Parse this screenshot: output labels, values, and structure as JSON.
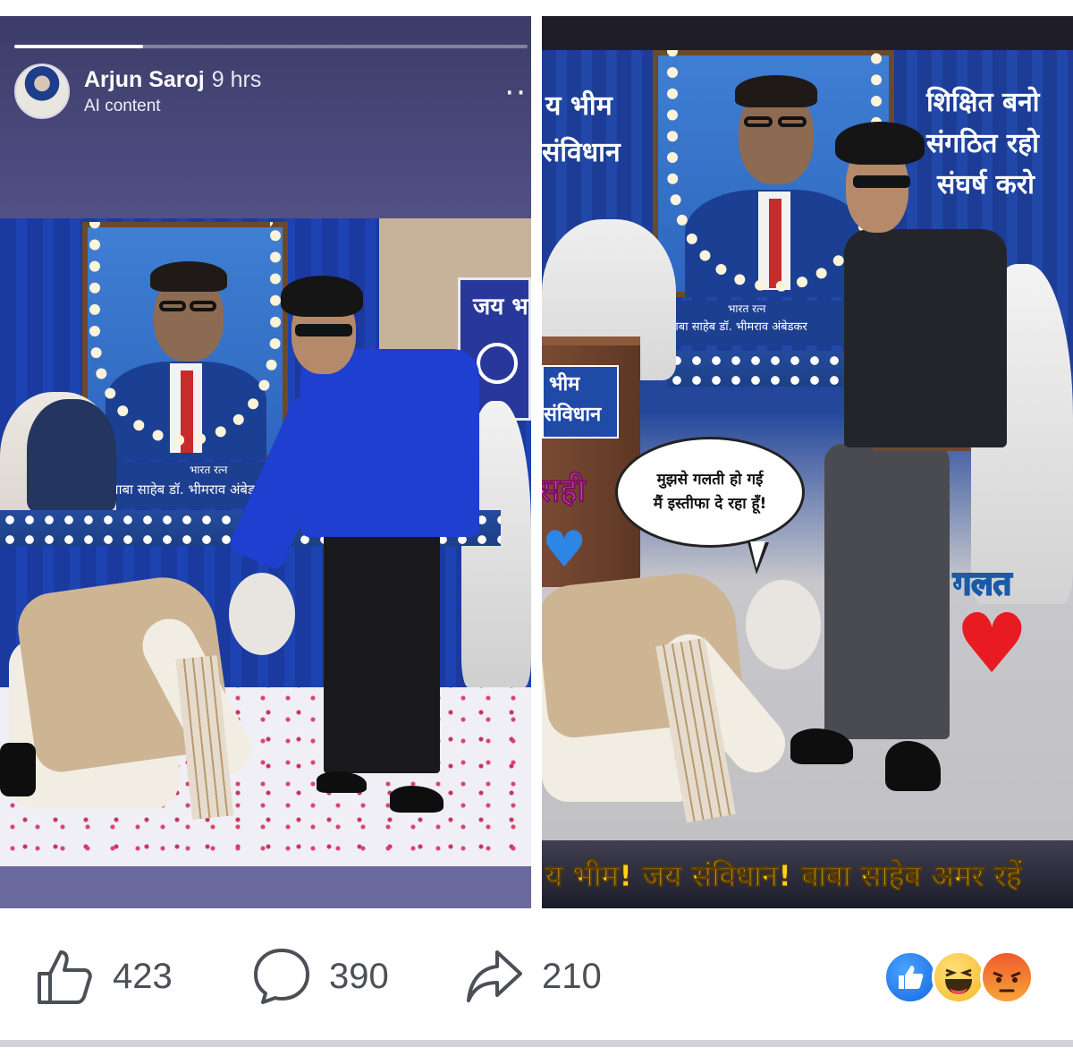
{
  "post": {
    "author_name": "Arjun Saroj",
    "time_ago": "9 hrs",
    "label": "AI content",
    "more_icon": "more-dots-icon",
    "story_progress": 0.25
  },
  "left_image": {
    "banner_partial": "जय भ",
    "portrait_caption_line1": "भारत रत्न",
    "portrait_caption_line2": "बाबा साहेब डॉ. भीमराव अंबेडकर"
  },
  "right_image": {
    "banner_left_line1": "य भीम",
    "banner_left_line2": "संविधान",
    "banner_right_line1": "शिक्षित बनो",
    "banner_right_line2": "संगठित रहो",
    "banner_right_line3": "संघर्ष करो",
    "portrait_caption_line1": "भारत रत्न",
    "portrait_caption_line2": "बाबा साहेब डॉ. भीमराव अंबेडकर",
    "podium_line1": "भीम",
    "podium_line2": "संविधान",
    "speech_line1": "मुझसे गलती हो गई",
    "speech_line2": "मैं इस्तीफा दे रहा हूँ!",
    "label_sahi": "सही",
    "label_galat": "गलत",
    "caption": "य भीम! जय संविधान! बाबा साहेब अमर रहें"
  },
  "actions": {
    "like_count": "423",
    "comment_count": "390",
    "share_count": "210",
    "like_icon": "thumbs-up-icon",
    "comment_icon": "comment-bubble-icon",
    "share_icon": "share-arrow-icon"
  },
  "reactions": [
    "like",
    "haha",
    "angry"
  ],
  "colors": {
    "story_bg": "#4d4c80",
    "caption_yellow": "#ffd21e",
    "action_gray": "#4b4f56",
    "like_blue": "#1877f2",
    "angry_orange": "#f05a2c"
  }
}
